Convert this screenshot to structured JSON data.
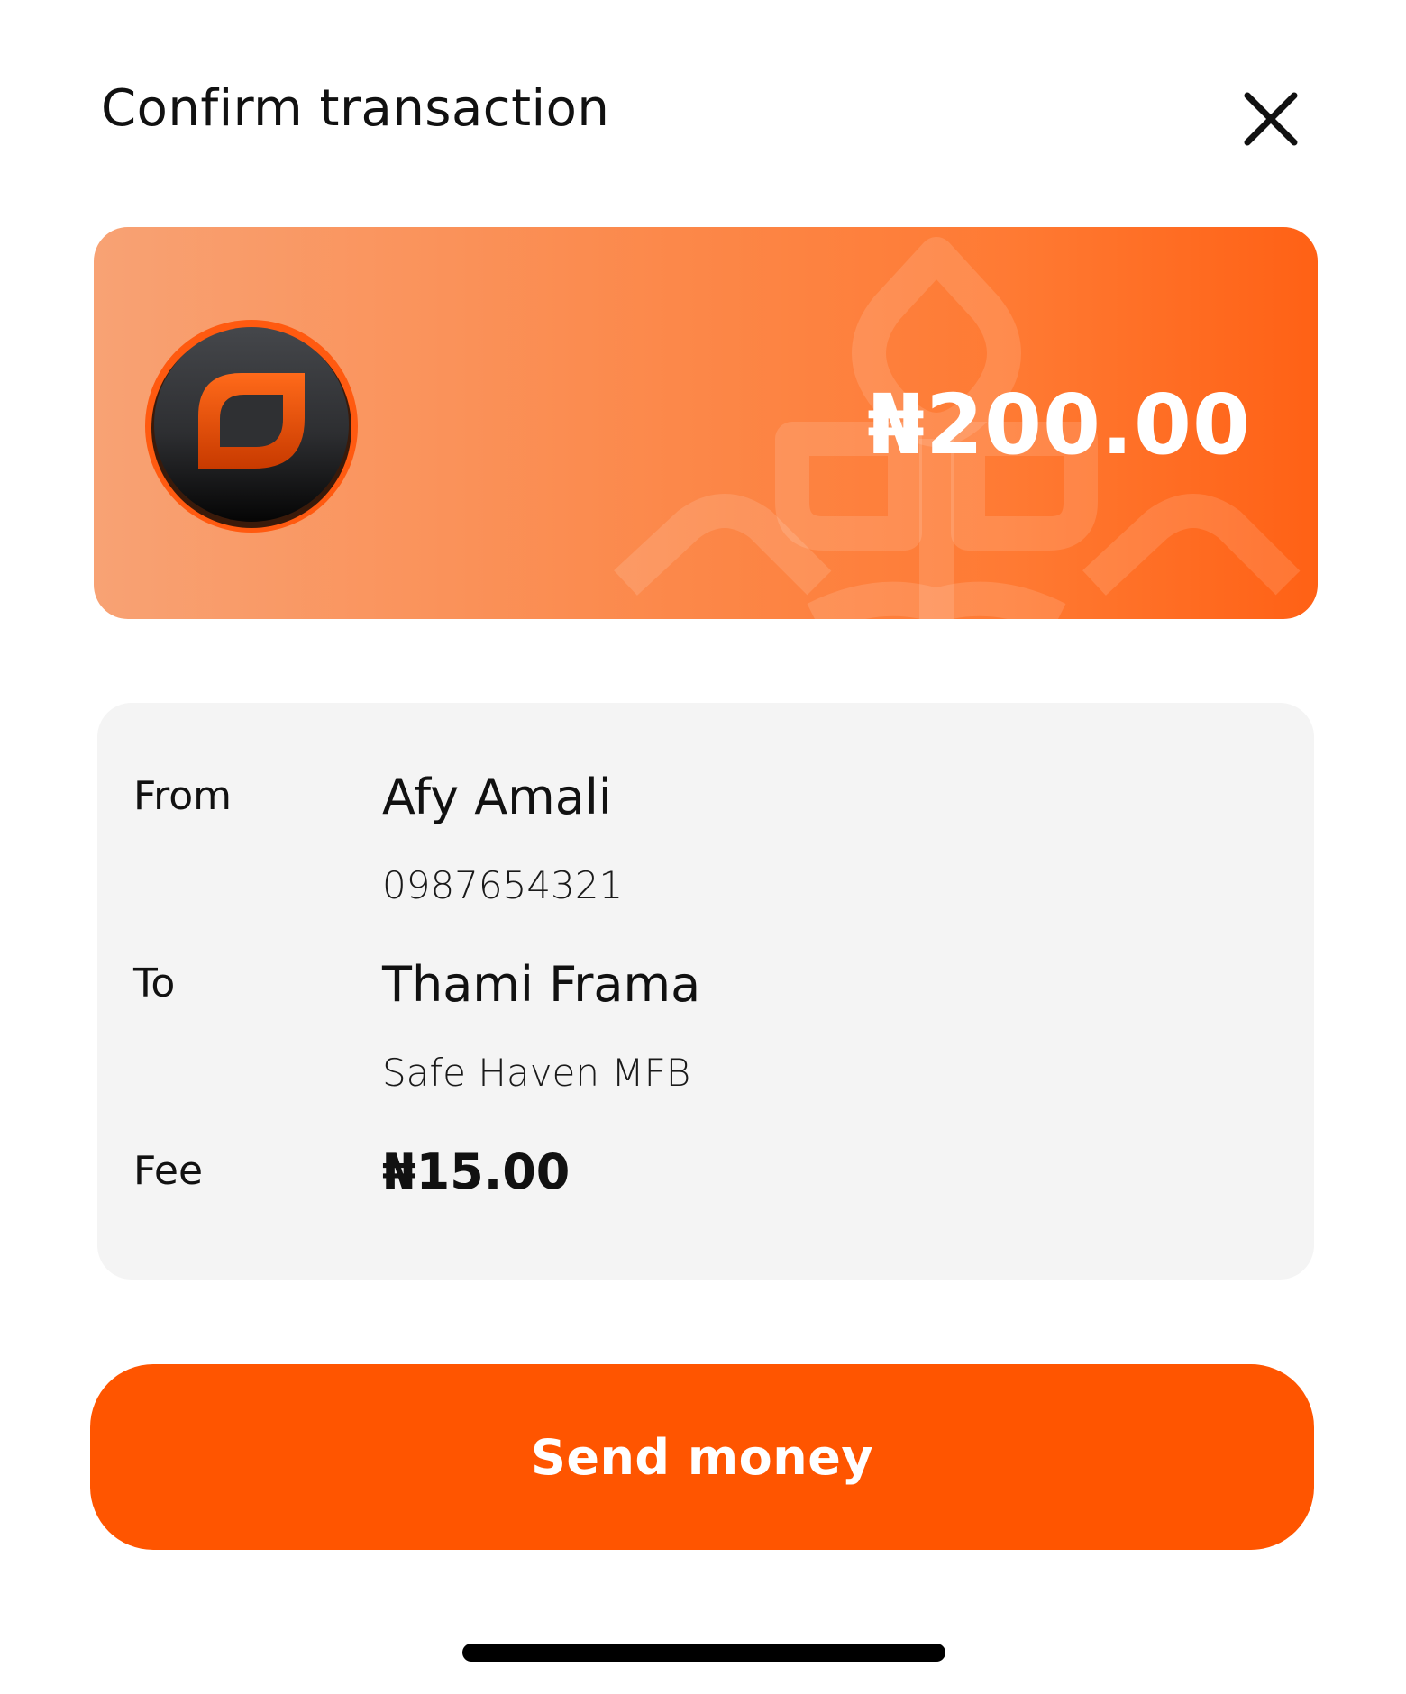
{
  "header": {
    "title": "Confirm transaction",
    "close_icon": "close-icon"
  },
  "amount_card": {
    "amount": "₦200.00",
    "logo_icon": "wallet-logo-coin-icon",
    "gradient_colors": [
      "#f8a274",
      "#ff6115"
    ]
  },
  "details": {
    "from": {
      "label": "From",
      "name": "Afy Amali",
      "account": "0987654321"
    },
    "to": {
      "label": "To",
      "name": "Thami Frama",
      "bank": "Safe Haven MFB"
    },
    "fee": {
      "label": "Fee",
      "value": "₦15.00"
    }
  },
  "actions": {
    "send_label": "Send money"
  },
  "colors": {
    "accent": "#ff5500",
    "details_bg": "#f4f4f4"
  }
}
